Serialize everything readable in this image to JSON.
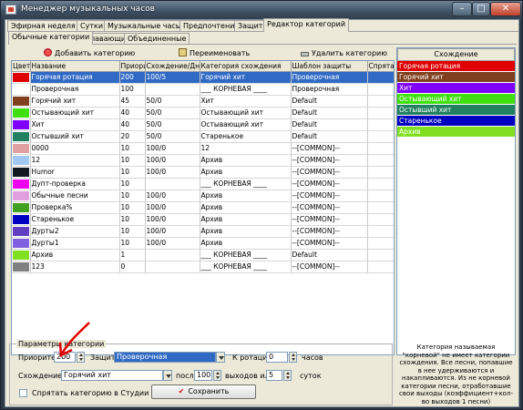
{
  "window": {
    "title": "Менеджер музыкальных часов"
  },
  "tabs": [
    "Эфирная неделя",
    "Сутки",
    "Музыкальные часы",
    "Предпочтения",
    "Защита",
    "Редактор категорий"
  ],
  "subtabs": [
    "Обычные категории",
    "Плавающие",
    "Объединенные"
  ],
  "toolbar": {
    "add_label": "Добавить категорию",
    "rename_label": "Переименовать",
    "delete_label": "Удалить категорию"
  },
  "table": {
    "columns": [
      "Цвет",
      "Название",
      "Приори-т",
      "Схождение/Дней",
      "Категория схождения",
      "Шаблон защиты",
      "Спрятан"
    ],
    "rows": [
      {
        "color": "#e00000",
        "name": "Горячая ротация",
        "prio": "200",
        "conv": "100/5",
        "cat": "Горячий хит",
        "tmpl": "Проверочная",
        "hidden": "",
        "selected": true
      },
      {
        "color": "#ffffff",
        "name": "Проверочная",
        "prio": "100",
        "conv": "",
        "cat": "___ КОРНЕВАЯ ____",
        "tmpl": "Проверочная",
        "hidden": ""
      },
      {
        "color": "#804020",
        "name": "Горячий хит",
        "prio": "45",
        "conv": "50/0",
        "cat": "Хит",
        "tmpl": "Default",
        "hidden": ""
      },
      {
        "color": "#40e010",
        "name": "Остывающий хит",
        "prio": "40",
        "conv": "50/0",
        "cat": "Остывающий хит",
        "tmpl": "Default",
        "hidden": ""
      },
      {
        "color": "#8000ff",
        "name": "Хит",
        "prio": "40",
        "conv": "50/0",
        "cat": "Остывающий хит",
        "tmpl": "Default",
        "hidden": ""
      },
      {
        "color": "#208060",
        "name": "Остывший хит",
        "prio": "20",
        "conv": "50/0",
        "cat": "Старенькое",
        "tmpl": "Default",
        "hidden": ""
      },
      {
        "color": "#e0a0a0",
        "name": "0000",
        "prio": "10",
        "conv": "100/0",
        "cat": "12",
        "tmpl": "--[COMMON]--",
        "hidden": ""
      },
      {
        "color": "#a0c8f0",
        "name": "12",
        "prio": "10",
        "conv": "100/0",
        "cat": "Архив",
        "tmpl": "--[COMMON]--",
        "hidden": ""
      },
      {
        "color": "#101820",
        "name": "Humor",
        "prio": "10",
        "conv": "100/0",
        "cat": "Архив",
        "tmpl": "--[COMMON]--",
        "hidden": ""
      },
      {
        "color": "#f000f0",
        "name": "Дупт-проверка",
        "prio": "10",
        "conv": "",
        "cat": "___ КОРНЕВАЯ ____",
        "tmpl": "--[COMMON]--",
        "hidden": ""
      },
      {
        "color": "#e0a0e0",
        "name": "Обычные песни",
        "prio": "10",
        "conv": "100/0",
        "cat": "Архив",
        "tmpl": "--[COMMON]--",
        "hidden": ""
      },
      {
        "color": "#40a020",
        "name": "Проверка%",
        "prio": "10",
        "conv": "100/0",
        "cat": "Архив",
        "tmpl": "--[COMMON]--",
        "hidden": ""
      },
      {
        "color": "#0000c0",
        "name": "Старенькое",
        "prio": "10",
        "conv": "100/0",
        "cat": "Архив",
        "tmpl": "--[COMMON]--",
        "hidden": ""
      },
      {
        "color": "#6040c0",
        "name": "Дурты2",
        "prio": "10",
        "conv": "100/0",
        "cat": "Архив",
        "tmpl": "--[COMMON]--",
        "hidden": ""
      },
      {
        "color": "#8060e0",
        "name": "Дурты1",
        "prio": "10",
        "conv": "100/0",
        "cat": "Архив",
        "tmpl": "--[COMMON]--",
        "hidden": ""
      },
      {
        "color": "#80e020",
        "name": "Архив",
        "prio": "1",
        "conv": "",
        "cat": "___ КОРНЕВАЯ ____",
        "tmpl": "Default",
        "hidden": ""
      },
      {
        "color": "#808080",
        "name": "123",
        "prio": "0",
        "conv": "",
        "cat": "___ КОРНЕВАЯ ____",
        "tmpl": "--[COMMON]--",
        "hidden": ""
      }
    ]
  },
  "convergence": {
    "header": "Схождение",
    "items": [
      {
        "label": "Горячая ротация",
        "color": "#e00000"
      },
      {
        "label": "Горячий хит",
        "color": "#804020"
      },
      {
        "label": "Хит",
        "color": "#8000ff"
      },
      {
        "label": "Остывающий хит",
        "color": "#40e010"
      },
      {
        "label": "Остывший хит",
        "color": "#208060"
      },
      {
        "label": "Старенькое",
        "color": "#0000c0"
      },
      {
        "label": "Архив",
        "color": "#80e020"
      }
    ]
  },
  "params": {
    "title": "Параметры категории",
    "priority_label": "Приоритет",
    "priority_value": "200",
    "protection_label": "Защита",
    "protection_value": "Проверочная",
    "rotation_label": "К ротации",
    "rotation_value": "0",
    "rotation_unit": "часов",
    "convergence_label": "Схождение в",
    "convergence_value": "Горячий хит",
    "after_label": "после",
    "after_value": "100",
    "plays_label": "выходов или",
    "days_value": "5",
    "days_unit": "суток",
    "hide_label": "Спрятать категорию в Студии",
    "save_label": "Сохранить"
  },
  "info": {
    "text": "Категория называемая \"корневой\" не имеет категории схождения. Все песни, попавшие в нее удерживаются и накапливаются. Из не корневой категории песни, отработавшие свои выходы (коэффициент+кол-во выходов 1 песни) перемещаются в указанную категорию схождения."
  },
  "colors": {
    "selection": "#316ac5",
    "annotation_arrow": "#e00000"
  }
}
